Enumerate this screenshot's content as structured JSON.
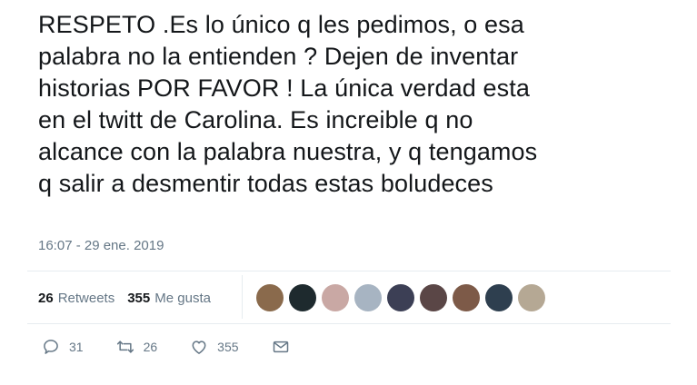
{
  "tweet": {
    "text": "RESPETO .Es lo único q les pedimos, o esa\npalabra no la entienden ? Dejen de inventar\nhistorias POR FAVOR ! La única verdad esta\nen el twitt de Carolina. Es increible q no\nalcance con la palabra nuestra, y q tengamos\nq salir a desmentir todas estas boludeces",
    "timestamp": "16:07 - 29 ene. 2019"
  },
  "stats": {
    "retweets_count": "26",
    "retweets_label": "Retweets",
    "likes_count": "355",
    "likes_label": "Me gusta"
  },
  "avatars": [
    {
      "name": "avatar-1",
      "color": "#8a6a4c"
    },
    {
      "name": "avatar-2",
      "color": "#1e2a2e"
    },
    {
      "name": "avatar-3",
      "color": "#c9a8a4"
    },
    {
      "name": "avatar-4",
      "color": "#a7b4c2"
    },
    {
      "name": "avatar-5",
      "color": "#3c3f55"
    },
    {
      "name": "avatar-6",
      "color": "#5a4646"
    },
    {
      "name": "avatar-7",
      "color": "#7d5a48"
    },
    {
      "name": "avatar-8",
      "color": "#2e3f4f"
    },
    {
      "name": "avatar-9",
      "color": "#b5a894"
    }
  ],
  "actions": {
    "reply_count": "31",
    "retweet_count": "26",
    "like_count": "355"
  },
  "colors": {
    "text": "#14171a",
    "secondary": "#657786",
    "divider": "#e6ecf0"
  }
}
